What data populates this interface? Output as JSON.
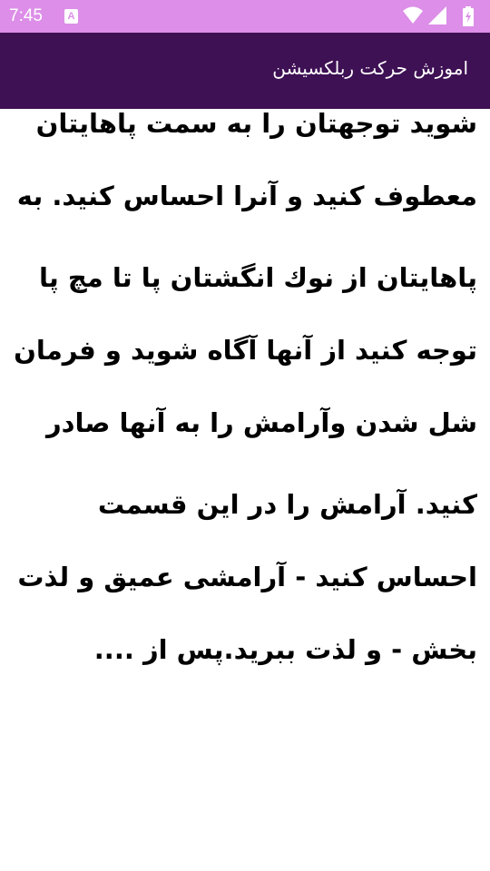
{
  "status_bar": {
    "time": "7:45",
    "notification_icon": "a-notification-icon",
    "icons": [
      "wifi-icon",
      "signal-icon",
      "battery-icon"
    ]
  },
  "app_bar": {
    "title": "اموزش حرکت ربلکسیشن"
  },
  "content": {
    "paragraphs": [
      "شوید  توجهتان را به سمت پاهایتان معطوف کنید و آنرا احساس کنید. به",
      "پاهایتان از نوك انگشتان پا تا مچ پا  توجه کنید از آنها آگاه شوید و فرمان شل شدن وآرامش را به آنها صادر",
      "کنید. آرامش را در این قسمت احساس کنید - آرامشی عمیق و لذت بخش -  و لذت ببرید.پس از ...."
    ]
  },
  "colors": {
    "status_bar": "#dc8ee8",
    "app_bar": "#3e1054",
    "text": "#000000"
  }
}
